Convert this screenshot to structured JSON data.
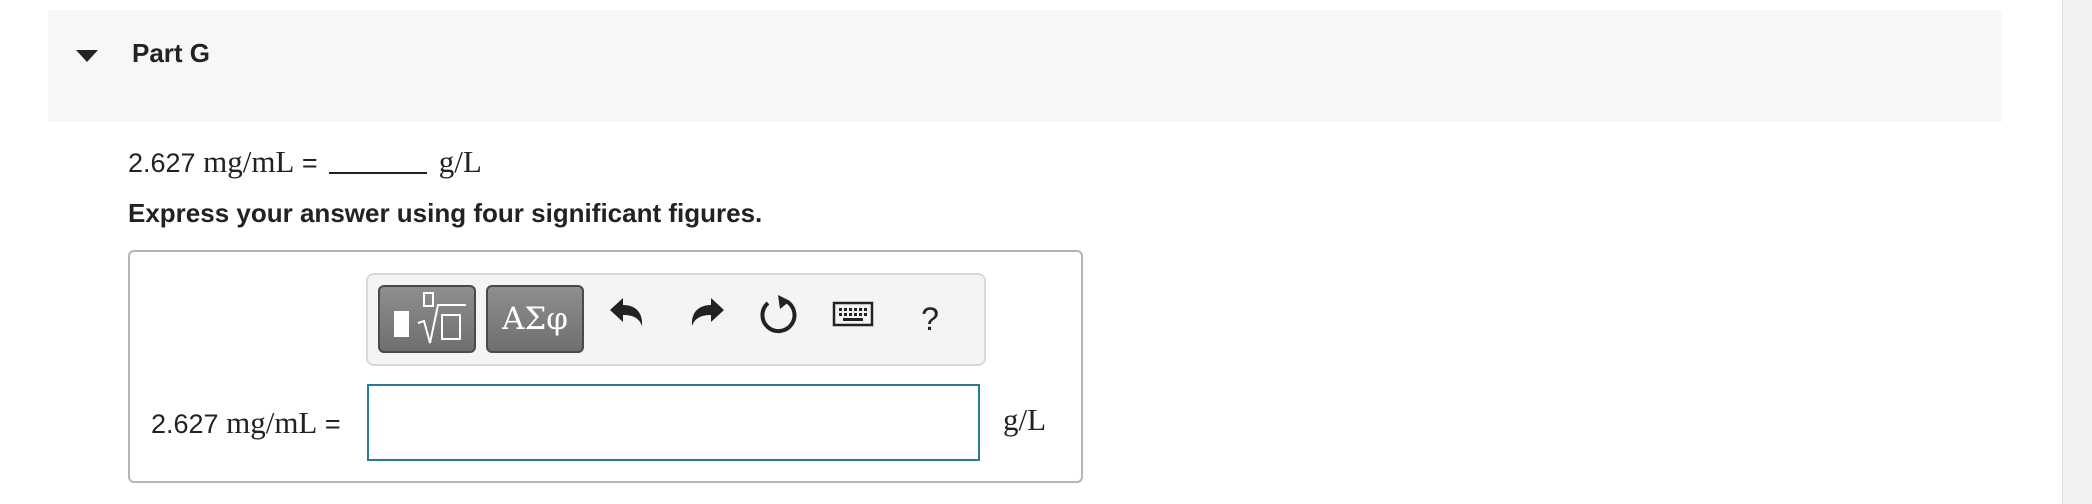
{
  "part": {
    "title": "Part G",
    "toggle_icon": "caret-down-icon"
  },
  "question": {
    "lhs_value": "2.627",
    "lhs_unit": "mg/mL",
    "equals": "=",
    "rhs_unit": "g/L"
  },
  "instruction": "Express your answer using four significant figures.",
  "toolbar": {
    "buttons": [
      {
        "name": "templates",
        "icon": "fraction-sqrt-template-icon"
      },
      {
        "name": "greek-symbols",
        "label": "ΑΣφ"
      },
      {
        "name": "undo",
        "icon": "undo-arrow-icon"
      },
      {
        "name": "redo",
        "icon": "redo-arrow-icon"
      },
      {
        "name": "reset",
        "icon": "reset-circular-arrow-icon"
      },
      {
        "name": "keyboard",
        "icon": "keyboard-icon"
      },
      {
        "name": "help",
        "label": "?"
      }
    ]
  },
  "answer": {
    "label_value": "2.627",
    "label_unit": "mg/mL",
    "equals": "=",
    "input_value": "",
    "unit": "g/L"
  },
  "colors": {
    "header_bg": "#f7f7f7",
    "input_border": "#2b7a94",
    "button_gray": "#7d7d7d"
  }
}
